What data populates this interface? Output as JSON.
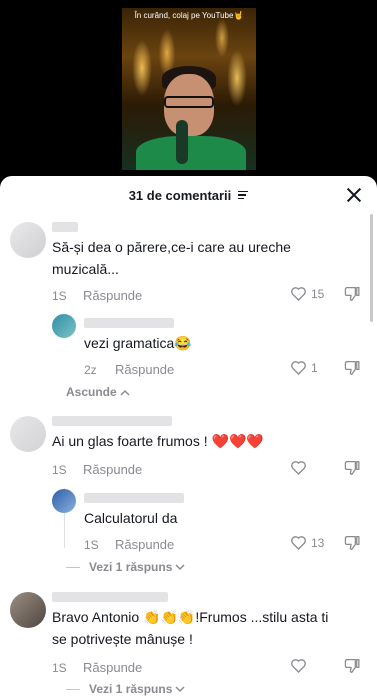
{
  "video": {
    "caption": "În curând, colaj pe YouTube🤘"
  },
  "comments_sheet": {
    "title": "31 de comentarii",
    "colors": {
      "text": "#161823",
      "muted": "#8a8b91",
      "like_red": "#fe2c55"
    }
  },
  "comments": [
    {
      "text": "Să-și dea o părere,ce-i care au ureche muzicală...",
      "time": "1S",
      "reply_label": "Răspunde",
      "likes": "15"
    },
    {
      "text": "vezi gramatica😂",
      "time": "2z",
      "reply_label": "Răspunde",
      "likes": "1",
      "toggle_label": "Ascunde"
    },
    {
      "text": "Ai un glas foarte frumos ! ❤️❤️❤️",
      "time": "1S",
      "reply_label": "Răspunde",
      "likes": ""
    },
    {
      "text": "Calculatorul da",
      "time": "1S",
      "reply_label": "Răspunde",
      "likes": "13",
      "toggle_label": "Vezi 1 răspuns"
    },
    {
      "text": "Bravo Antonio 👏👏👏!Frumos ...stilu asta ti se potrivește mânușe !",
      "time": "1S",
      "reply_label": "Răspunde",
      "likes": "",
      "toggle_label": "Vezi 1 răspuns"
    }
  ],
  "icons": {
    "filter": "filter-icon",
    "close": "close-icon",
    "heart": "heart-icon",
    "dislike": "dislike-icon",
    "chevron_up": "chevron-up-icon",
    "chevron_down": "chevron-down-icon"
  }
}
